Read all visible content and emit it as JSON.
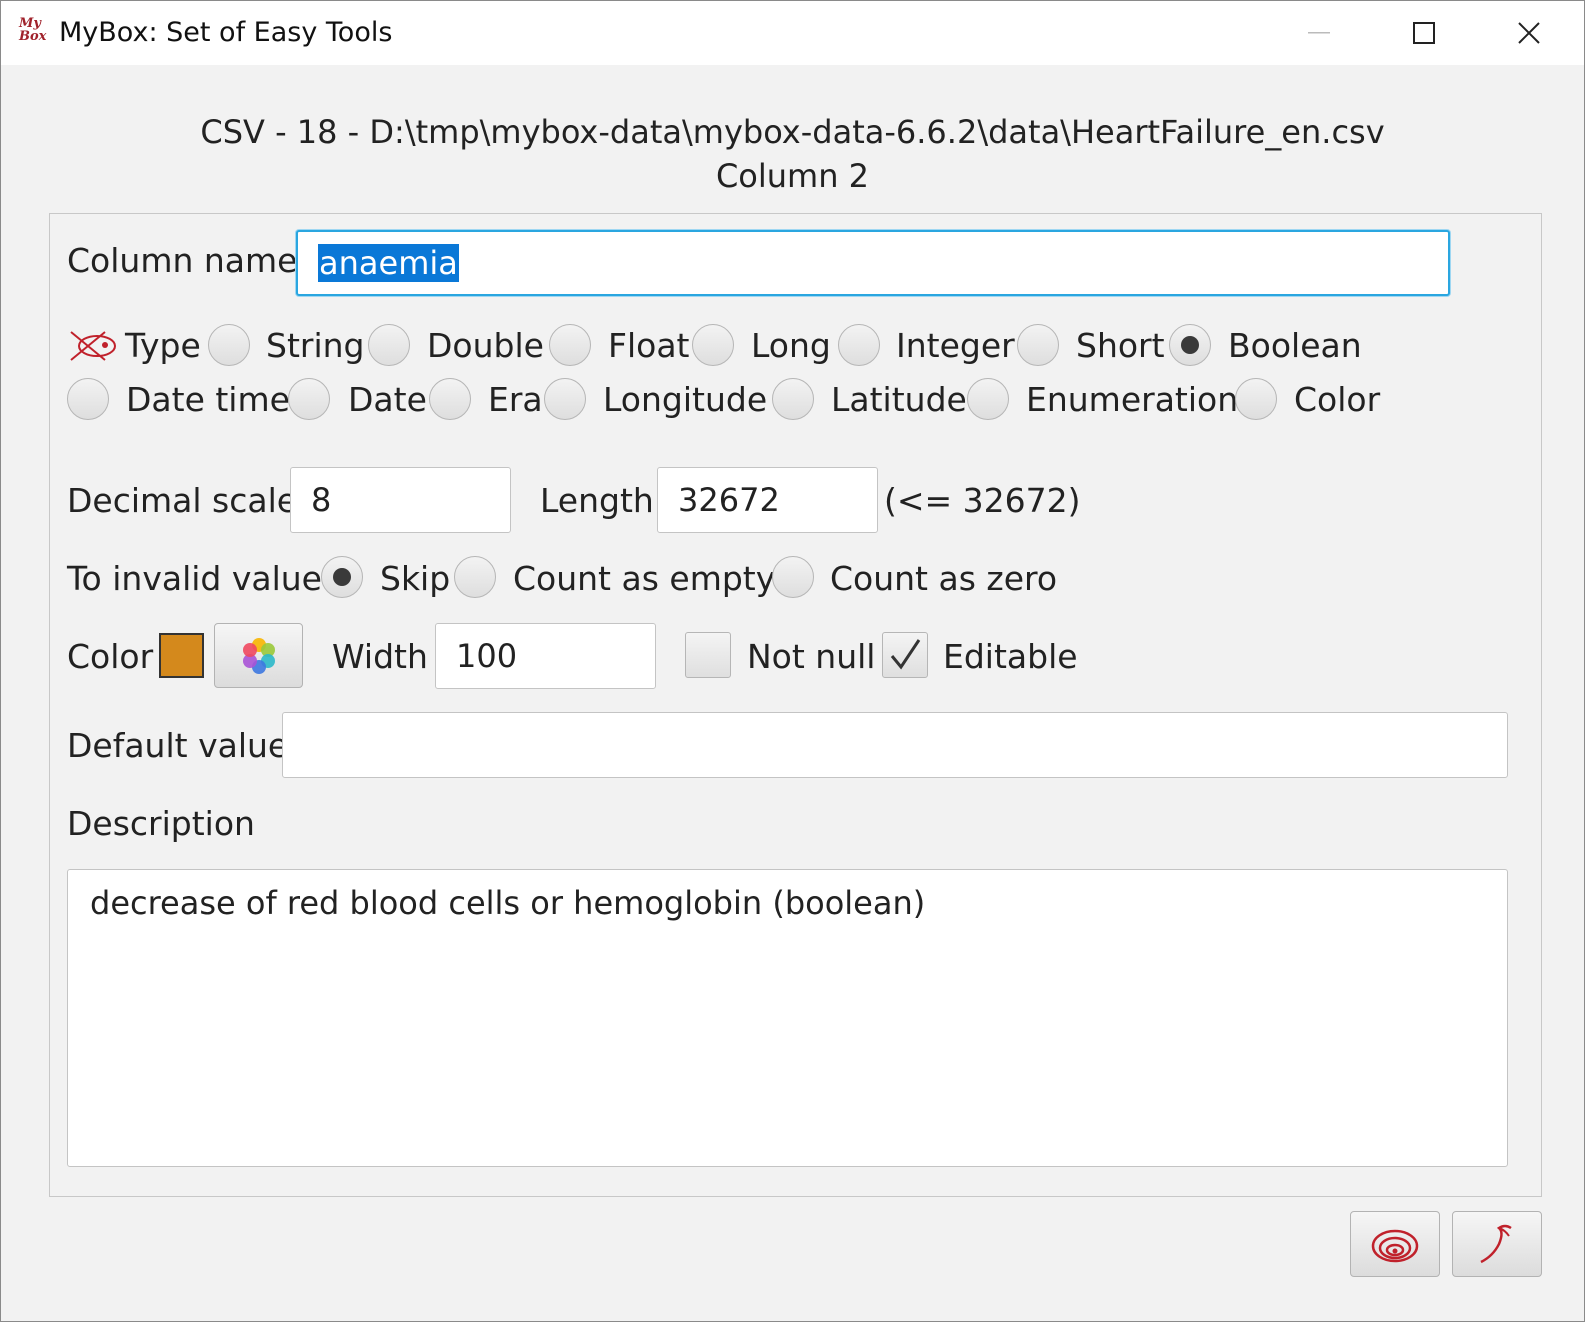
{
  "window": {
    "logo_text": "My Box",
    "title": "MyBox: Set of Easy Tools"
  },
  "header": {
    "file_line": "CSV - 18 - D:\\tmp\\mybox-data\\mybox-data-6.6.2\\data\\HeartFailure_en.csv",
    "column_line": "Column 2"
  },
  "form": {
    "column_name_label": "Column name",
    "column_name_value": "anaemia",
    "type_label": "Type",
    "types": [
      {
        "label": "String",
        "selected": false
      },
      {
        "label": "Double",
        "selected": false
      },
      {
        "label": "Float",
        "selected": false
      },
      {
        "label": "Long",
        "selected": false
      },
      {
        "label": "Integer",
        "selected": false
      },
      {
        "label": "Short",
        "selected": false
      },
      {
        "label": "Boolean",
        "selected": true
      },
      {
        "label": "Date time",
        "selected": false
      },
      {
        "label": "Date",
        "selected": false
      },
      {
        "label": "Era",
        "selected": false
      },
      {
        "label": "Longitude",
        "selected": false
      },
      {
        "label": "Latitude",
        "selected": false
      },
      {
        "label": "Enumeration",
        "selected": false
      },
      {
        "label": "Color",
        "selected": false
      }
    ],
    "decimal_scale_label": "Decimal scale",
    "decimal_scale_value": "8",
    "length_label": "Length",
    "length_value": "32672",
    "length_hint": "(<= 32672)",
    "invalid_label": "To invalid value",
    "invalid_options": [
      {
        "label": "Skip",
        "selected": true
      },
      {
        "label": "Count as empty",
        "selected": false
      },
      {
        "label": "Count as zero",
        "selected": false
      }
    ],
    "color_label": "Color",
    "color_value": "#d4891c",
    "width_label": "Width",
    "width_value": "100",
    "not_null_label": "Not null",
    "not_null_checked": false,
    "editable_label": "Editable",
    "editable_checked": true,
    "default_value_label": "Default value",
    "default_value": "",
    "description_label": "Description",
    "description_value": "decrease of red blood cells or hemoglobin (boolean)"
  },
  "icons": {
    "app": "mybox-logo-icon",
    "type_tip": "tips-icon",
    "palette": "color-palette-icon",
    "ok": "ok-spiral-icon",
    "cancel": "cancel-hook-icon"
  }
}
